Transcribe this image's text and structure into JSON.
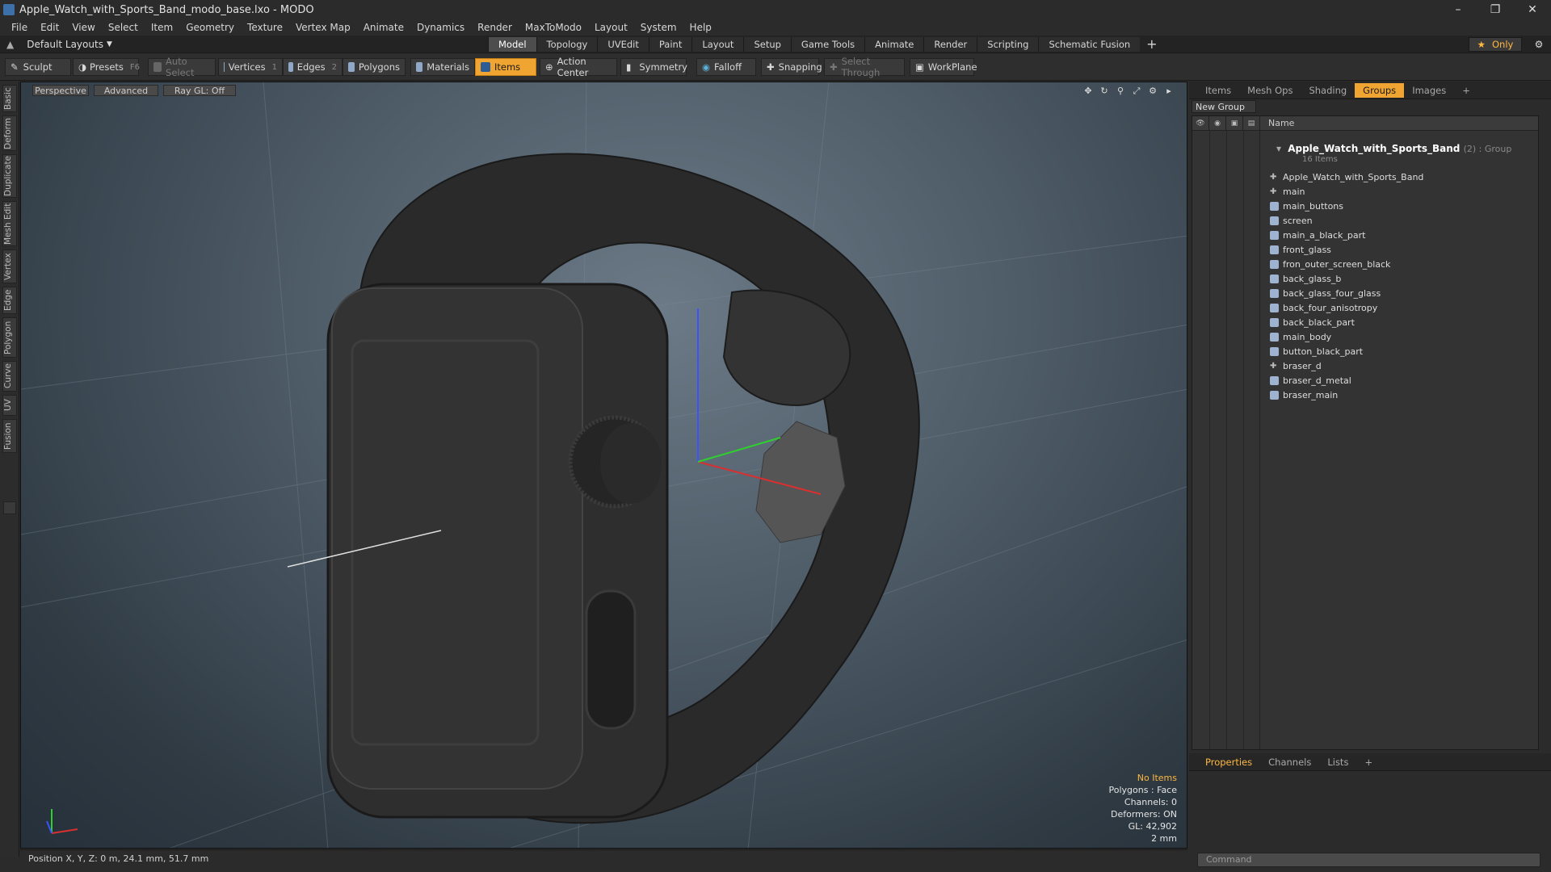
{
  "window": {
    "title": "Apple_Watch_with_Sports_Band_modo_base.lxo - MODO"
  },
  "menu": [
    "File",
    "Edit",
    "View",
    "Select",
    "Item",
    "Geometry",
    "Texture",
    "Vertex Map",
    "Animate",
    "Dynamics",
    "Render",
    "MaxToModo",
    "Layout",
    "System",
    "Help"
  ],
  "layout": {
    "preset": "Default Layouts",
    "tabs": [
      "Model",
      "Topology",
      "UVEdit",
      "Paint",
      "Layout",
      "Setup",
      "Game Tools",
      "Animate",
      "Render",
      "Scripting",
      "Schematic Fusion"
    ],
    "active_tab": "Model",
    "only_label": "Only"
  },
  "toolbar": {
    "sculpt": "Sculpt",
    "presets": "Presets",
    "presets_key": "F6",
    "auto_select": "Auto Select",
    "vertices": "Vertices",
    "vertices_key": "1",
    "edges": "Edges",
    "edges_key": "2",
    "polygons": "Polygons",
    "materials": "Materials",
    "items": "Items",
    "action_center": "Action Center",
    "symmetry": "Symmetry",
    "falloff": "Falloff",
    "snapping": "Snapping",
    "select_through": "Select Through",
    "workplane": "WorkPlane"
  },
  "left_tabs": [
    "Basic",
    "Deform",
    "Duplicate",
    "Mesh Edit",
    "Vertex",
    "Edge",
    "Polygon",
    "Curve",
    "UV",
    "Fusion"
  ],
  "viewport": {
    "view": "Perspective",
    "shading": "Advanced",
    "raygl": "Ray GL: Off",
    "info": {
      "selection": "No Items",
      "polygons": "Polygons : Face",
      "channels": "Channels: 0",
      "deformers": "Deformers: ON",
      "gl": "GL: 42,902",
      "grid": "2 mm"
    }
  },
  "status": {
    "position": "Position X, Y, Z:  0 m, 24.1 mm, 51.7 mm"
  },
  "panel": {
    "tabs": [
      "Items",
      "Mesh Ops",
      "Shading",
      "Groups",
      "Images"
    ],
    "active_tab": "Groups",
    "new_group": "New Group",
    "name_header": "Name",
    "group_name": "Apple_Watch_with_Sports_Band",
    "group_type": "(2) : Group",
    "group_count": "16 Items",
    "items": [
      {
        "name": "Apple_Watch_with_Sports_Band",
        "icon": "locator-icon"
      },
      {
        "name": "main",
        "icon": "locator-icon"
      },
      {
        "name": "main_buttons",
        "icon": "mesh-icon"
      },
      {
        "name": "screen",
        "icon": "mesh-icon"
      },
      {
        "name": "main_a_black_part",
        "icon": "mesh-icon"
      },
      {
        "name": "front_glass",
        "icon": "mesh-icon"
      },
      {
        "name": "fron_outer_screen_black",
        "icon": "mesh-icon"
      },
      {
        "name": "back_glass_b",
        "icon": "mesh-icon"
      },
      {
        "name": "back_glass_four_glass",
        "icon": "mesh-icon"
      },
      {
        "name": "back_four_anisotropy",
        "icon": "mesh-icon"
      },
      {
        "name": "back_black_part",
        "icon": "mesh-icon"
      },
      {
        "name": "main_body",
        "icon": "mesh-icon"
      },
      {
        "name": "button_black_part",
        "icon": "mesh-icon"
      },
      {
        "name": "braser_d",
        "icon": "locator-icon"
      },
      {
        "name": "braser_d_metal",
        "icon": "mesh-icon"
      },
      {
        "name": "braser_main",
        "icon": "mesh-icon"
      }
    ],
    "bottom_tabs": [
      "Properties",
      "Channels",
      "Lists"
    ],
    "bottom_active": "Properties",
    "command_placeholder": "Command"
  },
  "colors": {
    "accent": "#f0a532",
    "highlight_text": "#ffb840"
  }
}
